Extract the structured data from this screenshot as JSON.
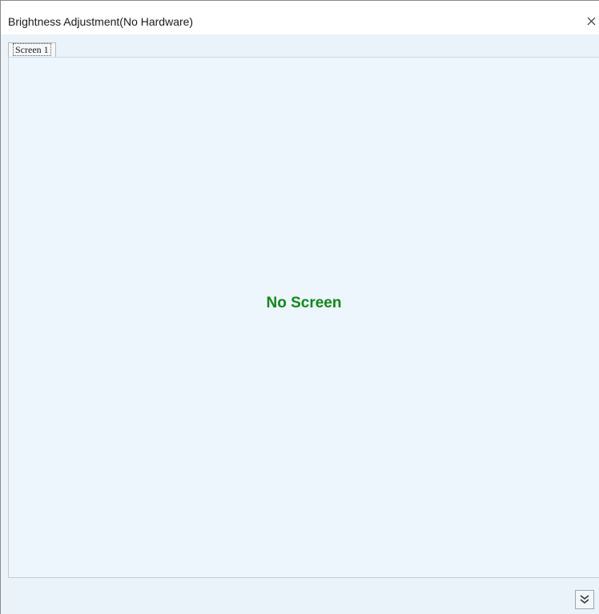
{
  "window": {
    "title": "Brightness Adjustment(No Hardware)",
    "close_icon": "close-icon"
  },
  "tabs": [
    {
      "label": "Screen 1",
      "selected": true
    }
  ],
  "panel": {
    "message": "No Screen",
    "message_color": "#0c8a14"
  },
  "footer": {
    "expand_icon": "double-chevron-down-icon"
  }
}
